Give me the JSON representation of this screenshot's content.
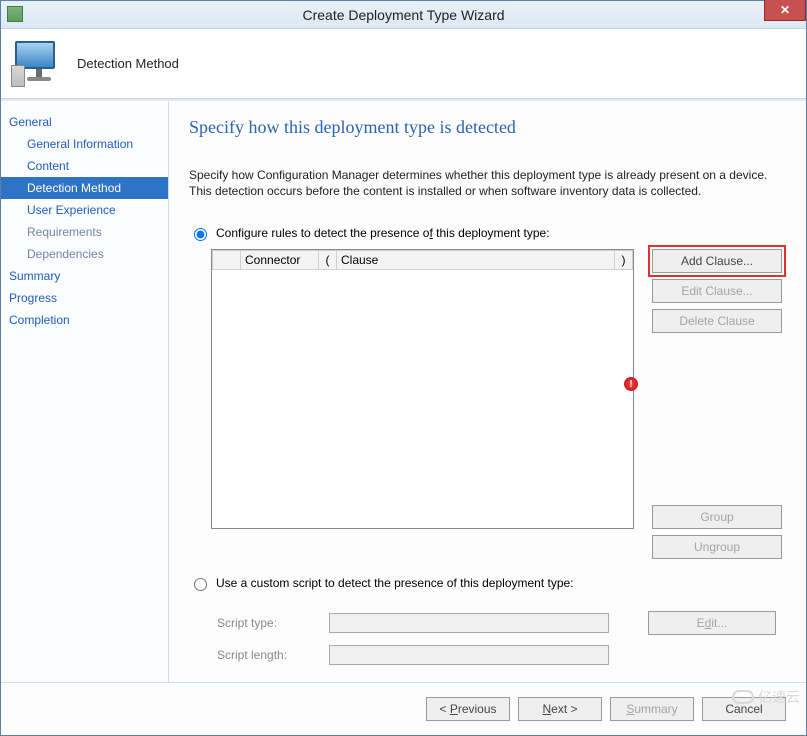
{
  "window": {
    "title": "Create Deployment Type Wizard"
  },
  "header": {
    "stage_title": "Detection Method"
  },
  "sidebar": {
    "items": [
      {
        "label": "General",
        "cls": "top"
      },
      {
        "label": "General Information",
        "cls": "sub"
      },
      {
        "label": "Content",
        "cls": "sub"
      },
      {
        "label": "Detection Method",
        "cls": "sub sel"
      },
      {
        "label": "User Experience",
        "cls": "sub"
      },
      {
        "label": "Requirements",
        "cls": "sub disabled"
      },
      {
        "label": "Dependencies",
        "cls": "sub disabled"
      },
      {
        "label": "Summary",
        "cls": "top"
      },
      {
        "label": "Progress",
        "cls": "top"
      },
      {
        "label": "Completion",
        "cls": "top"
      }
    ]
  },
  "main": {
    "heading": "Specify how this deployment type is detected",
    "intro": "Specify how Configuration Manager determines whether this deployment type is already present on a device. This detection occurs before the content is installed or when software inventory data is collected.",
    "radio_rules_label": "Configure rules to detect the presence of this deployment type:",
    "radio_script_label": "Use a custom script to detect the presence of this deployment type:",
    "grid": {
      "columns": [
        "",
        "Connector",
        "(",
        "Clause",
        ")"
      ]
    },
    "buttons": {
      "add_clause": "Add Clause...",
      "edit_clause": "Edit Clause...",
      "delete_clause": "Delete Clause",
      "group": "Group",
      "ungroup": "Ungroup",
      "script_edit": "Edit..."
    },
    "script": {
      "type_label": "Script type:",
      "length_label": "Script length:",
      "type_value": "",
      "length_value": ""
    }
  },
  "footer": {
    "previous": "< Previous",
    "next": "Next >",
    "summary": "Summary",
    "cancel": "Cancel"
  },
  "watermark": "亿速云"
}
